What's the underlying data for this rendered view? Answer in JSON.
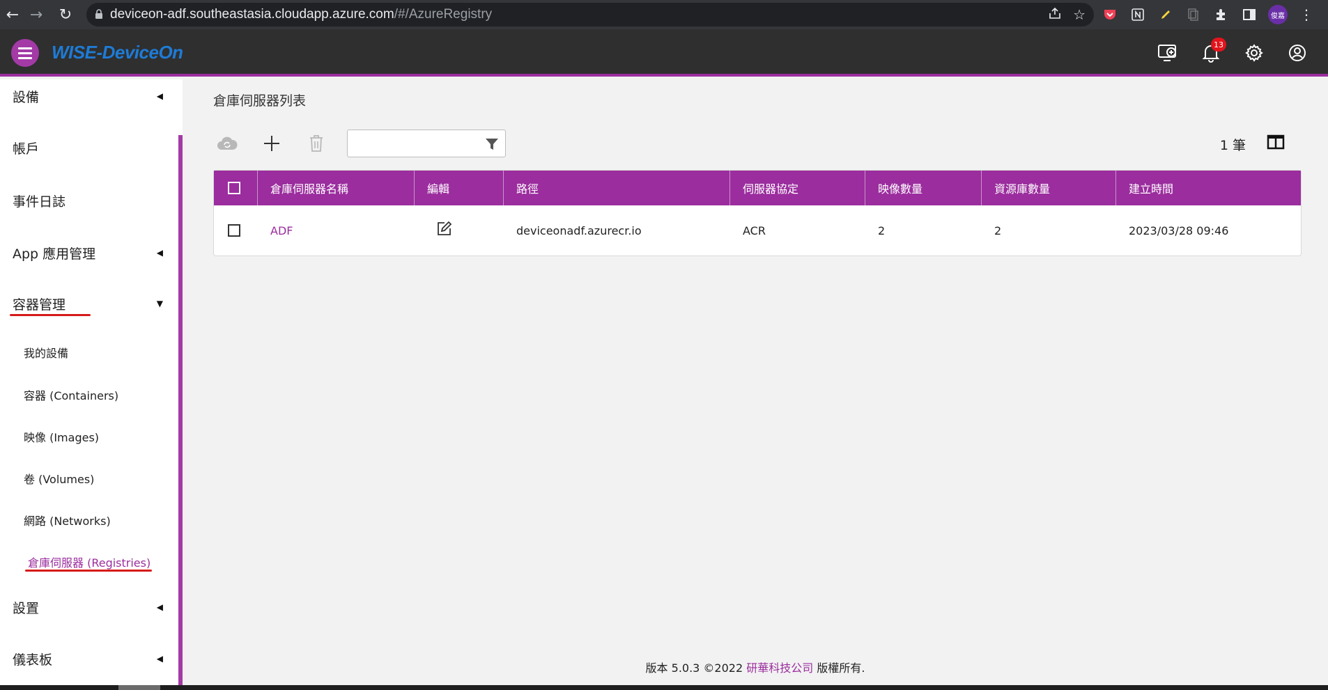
{
  "browser": {
    "url_host": "deviceon-adf.southeastasia.cloudapp.azure.com",
    "url_path": "/#/AzureRegistry",
    "profile_label": "俊嘉"
  },
  "header": {
    "brand": "WISE-DeviceOn",
    "notification_count": "13"
  },
  "sidebar": {
    "items": [
      {
        "label": "設備",
        "arrow": "◀"
      },
      {
        "label": "帳戶",
        "arrow": ""
      },
      {
        "label": "事件日誌",
        "arrow": ""
      },
      {
        "label": "App 應用管理",
        "arrow": "◀"
      },
      {
        "label": "容器管理",
        "arrow": "▼"
      },
      {
        "label": "設置",
        "arrow": "◀"
      },
      {
        "label": "儀表板",
        "arrow": "◀"
      }
    ],
    "sub_items": [
      {
        "label": "我的設備"
      },
      {
        "label": "容器 (Containers)"
      },
      {
        "label": "映像 (Images)"
      },
      {
        "label": "卷 (Volumes)"
      },
      {
        "label": "網路 (Networks)"
      },
      {
        "label": "倉庫伺服器 (Registries)"
      }
    ]
  },
  "main": {
    "title": "倉庫伺服器列表",
    "filter_value": "",
    "count_label": "1 筆",
    "columns": [
      "倉庫伺服器名稱",
      "編輯",
      "路徑",
      "伺服器協定",
      "映像數量",
      "資源庫數量",
      "建立時間"
    ],
    "rows": [
      {
        "name": "ADF",
        "path": "deviceonadf.azurecr.io",
        "protocol": "ACR",
        "images": "2",
        "repos": "2",
        "created": "2023/03/28 09:46"
      }
    ]
  },
  "footer": {
    "prefix": "版本 5.0.3 ©2022",
    "company": "研華科技公司",
    "suffix": "版權所有."
  },
  "colors": {
    "accent": "#9b2d9e",
    "header_bg": "#2f2f2f",
    "brand": "#1e7bd6",
    "annotation": "#d71a1a"
  }
}
